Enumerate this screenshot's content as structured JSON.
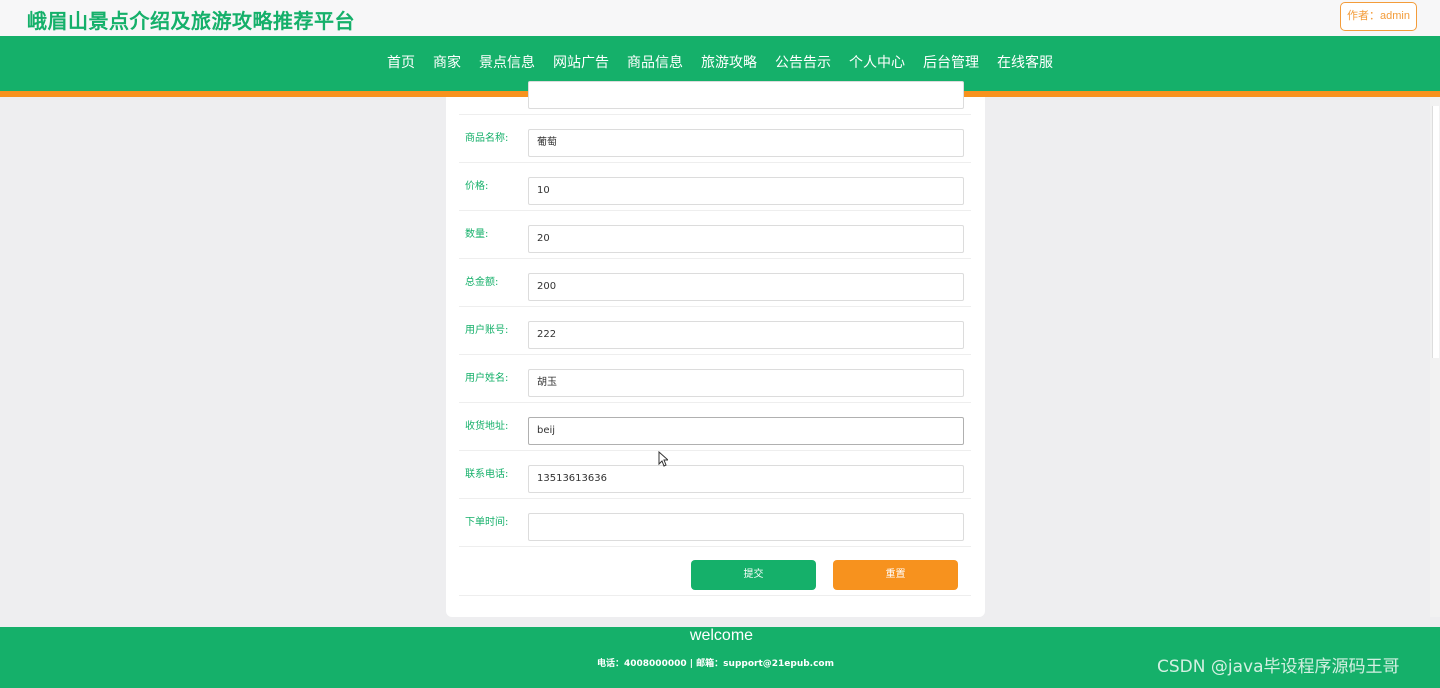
{
  "header": {
    "site_title": "峨眉山景点介绍及旅游攻略推荐平台",
    "author_label": "作者：admin"
  },
  "nav": {
    "items": [
      "首页",
      "商家",
      "景点信息",
      "网站广告",
      "商品信息",
      "旅游攻略",
      "公告告示",
      "个人中心",
      "后台管理",
      "在线客服"
    ]
  },
  "form": {
    "fields": [
      {
        "label": "商品名称:",
        "value": "葡萄"
      },
      {
        "label": "价格:",
        "value": "10"
      },
      {
        "label": "数量:",
        "value": "20"
      },
      {
        "label": "总金额:",
        "value": "200"
      },
      {
        "label": "用户账号:",
        "value": "222"
      },
      {
        "label": "用户姓名:",
        "value": "胡玉"
      },
      {
        "label": "收货地址:",
        "value": "beij"
      },
      {
        "label": "联系电话:",
        "value": "13513613636"
      },
      {
        "label": "下单时间:",
        "value": ""
      }
    ],
    "submit_label": "提交",
    "reset_label": "重置"
  },
  "footer": {
    "welcome": "welcome",
    "contact": "电话：4008000000 | 邮箱：support@21epub.com"
  },
  "watermark": "CSDN @java毕设程序源码王哥",
  "colors": {
    "brand_green": "#15b06a",
    "accent_orange": "#f7921e"
  }
}
